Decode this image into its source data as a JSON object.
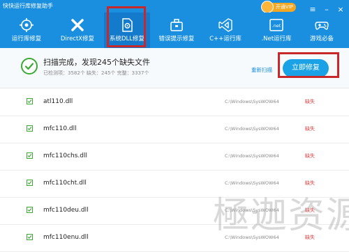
{
  "app": {
    "title": "快快运行库修复助手",
    "vip_label": "开通VIP"
  },
  "nav": [
    {
      "label": "运行库修复",
      "icon": "target-icon"
    },
    {
      "label": "DirectX修复",
      "icon": "directx-icon"
    },
    {
      "label": "系统DLL修复",
      "icon": "gear-doc-icon"
    },
    {
      "label": "错误提示修复",
      "icon": "toolbox-icon"
    },
    {
      "label": "C++运行库",
      "icon": "visual-studio-icon"
    },
    {
      "label": ".Net运行库",
      "icon": "net-icon"
    },
    {
      "label": "游戏必备",
      "icon": "gamepad-icon"
    }
  ],
  "summary": {
    "title": "扫描完成，发现245个缺失文件",
    "stats": "已检测项：3582个    缺失：245个    完整：3337个",
    "rescan": "重新扫描",
    "fix_button": "立即修复"
  },
  "files": [
    {
      "name": "atl110.dll",
      "path": "C:\\Windows\\SysWOW64",
      "status": "缺失"
    },
    {
      "name": "mfc110.dll",
      "path": "C:\\Windows\\SysWOW64",
      "status": "缺失"
    },
    {
      "name": "mfc110chs.dll",
      "path": "C:\\Windows\\SysWOW64",
      "status": "缺失"
    },
    {
      "name": "mfc110cht.dll",
      "path": "C:\\Windows\\SysWOW64",
      "status": "缺失"
    },
    {
      "name": "mfc110deu.dll",
      "path": "C:\\Windows\\SysWOW64",
      "status": "缺失"
    },
    {
      "name": "mfc110enu.dll",
      "path": "C:\\Windows\\SysWOW64",
      "status": "缺失"
    }
  ],
  "watermark": "極迦资源",
  "colors": {
    "brand": "#1a8fe0",
    "highlight": "#c9282a",
    "ok": "#3aaa35",
    "missing": "#e03b3b",
    "button": "#1ba2e6"
  }
}
